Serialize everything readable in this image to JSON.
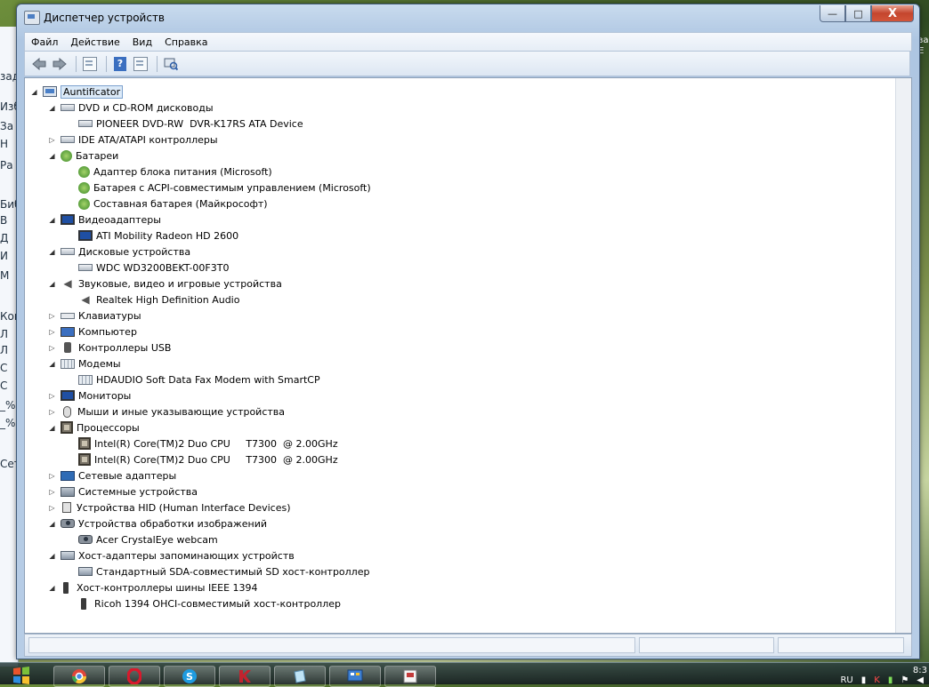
{
  "window": {
    "title": "Диспетчер устройств",
    "caption_buttons": {
      "minimize": "—",
      "maximize": "□",
      "close": "X"
    }
  },
  "menu": [
    "Файл",
    "Действие",
    "Вид",
    "Справка"
  ],
  "toolbar": {
    "buttons": [
      "back-arrow-icon",
      "forward-arrow-icon",
      "properties-sheet-icon",
      "help-icon",
      "details-sheet-icon",
      "scan-hardware-icon"
    ],
    "help_glyph": "?"
  },
  "tree": [
    {
      "label": "Auntificator",
      "level": 0,
      "expander": "open",
      "icon": "pc"
    },
    {
      "label": "DVD и CD-ROM дисководы",
      "level": 1,
      "expander": "open",
      "icon": "drive"
    },
    {
      "label": "PIONEER DVD-RW  DVR-K17RS ATA Device",
      "level": 2,
      "icon": "drive"
    },
    {
      "label": "IDE ATA/ATAPI контроллеры",
      "level": 1,
      "expander": "closed",
      "icon": "drive"
    },
    {
      "label": "Батареи",
      "level": 1,
      "expander": "open",
      "icon": "battery"
    },
    {
      "label": "Адаптер блока питания (Microsoft)",
      "level": 2,
      "icon": "battery"
    },
    {
      "label": "Батарея с ACPI-совместимым управлением (Microsoft)",
      "level": 2,
      "icon": "battery"
    },
    {
      "label": "Составная батарея (Майкрософт)",
      "level": 2,
      "icon": "battery"
    },
    {
      "label": "Видеоадаптеры",
      "level": 1,
      "expander": "open",
      "icon": "monitor"
    },
    {
      "label": "ATI Mobility Radeon HD 2600",
      "level": 2,
      "icon": "monitor"
    },
    {
      "label": "Дисковые устройства",
      "level": 1,
      "expander": "open",
      "icon": "drive"
    },
    {
      "label": "WDC WD3200BEKT-00F3T0",
      "level": 2,
      "icon": "drive"
    },
    {
      "label": "Звуковые, видео и игровые устройства",
      "level": 1,
      "expander": "open",
      "icon": "sound"
    },
    {
      "label": "Realtek High Definition Audio",
      "level": 2,
      "icon": "sound"
    },
    {
      "label": "Клавиатуры",
      "level": 1,
      "expander": "closed",
      "icon": "kbd"
    },
    {
      "label": "Компьютер",
      "level": 1,
      "expander": "closed",
      "icon": "computer"
    },
    {
      "label": "Контроллеры USB",
      "level": 1,
      "expander": "closed",
      "icon": "usb"
    },
    {
      "label": "Модемы",
      "level": 1,
      "expander": "open",
      "icon": "modem"
    },
    {
      "label": "HDAUDIO Soft Data Fax Modem with SmartCP",
      "level": 2,
      "icon": "modem"
    },
    {
      "label": "Мониторы",
      "level": 1,
      "expander": "closed",
      "icon": "monitor"
    },
    {
      "label": "Мыши и иные указывающие устройства",
      "level": 1,
      "expander": "closed",
      "icon": "mouse"
    },
    {
      "label": "Процессоры",
      "level": 1,
      "expander": "open",
      "icon": "chip"
    },
    {
      "label": "Intel(R) Core(TM)2 Duo CPU     T7300  @ 2.00GHz",
      "level": 2,
      "icon": "chip"
    },
    {
      "label": "Intel(R) Core(TM)2 Duo CPU     T7300  @ 2.00GHz",
      "level": 2,
      "icon": "chip"
    },
    {
      "label": "Сетевые адаптеры",
      "level": 1,
      "expander": "closed",
      "icon": "net"
    },
    {
      "label": "Системные устройства",
      "level": 1,
      "expander": "closed",
      "icon": "sys"
    },
    {
      "label": "Устройства HID (Human Interface Devices)",
      "level": 1,
      "expander": "closed",
      "icon": "hid"
    },
    {
      "label": "Устройства обработки изображений",
      "level": 1,
      "expander": "open",
      "icon": "cam"
    },
    {
      "label": "Acer CrystalEye webcam",
      "level": 2,
      "icon": "cam"
    },
    {
      "label": "Хост-адаптеры запоминающих устройств",
      "level": 1,
      "expander": "open",
      "icon": "storage"
    },
    {
      "label": "Стандартный SDA-совместимый SD хост-контроллер",
      "level": 2,
      "icon": "storage"
    },
    {
      "label": "Хост-контроллеры шины IEEE 1394",
      "level": 1,
      "expander": "open",
      "icon": "plug"
    },
    {
      "label": "Ricoh 1394 OHCI-совместимый хост-контроллер",
      "level": 2,
      "icon": "plug"
    }
  ],
  "background": {
    "left_fragments": [
      "зад",
      "Изб",
      "За",
      "Н",
      "Ра",
      "Биб",
      "В",
      "Д",
      "И",
      "М",
      "Ком",
      "Л",
      "Л",
      "С",
      "С",
      "_%",
      "_%",
      "Сет"
    ],
    "right_fragments": [
      "зар",
      "Е"
    ]
  },
  "taskbar": {
    "apps": [
      "Google Chrome",
      "Opera",
      "Skype",
      "Kaspersky",
      "Notepad",
      "Control Panel",
      "Device Manager"
    ],
    "tray_lang": "RU",
    "clock": "8:3"
  }
}
